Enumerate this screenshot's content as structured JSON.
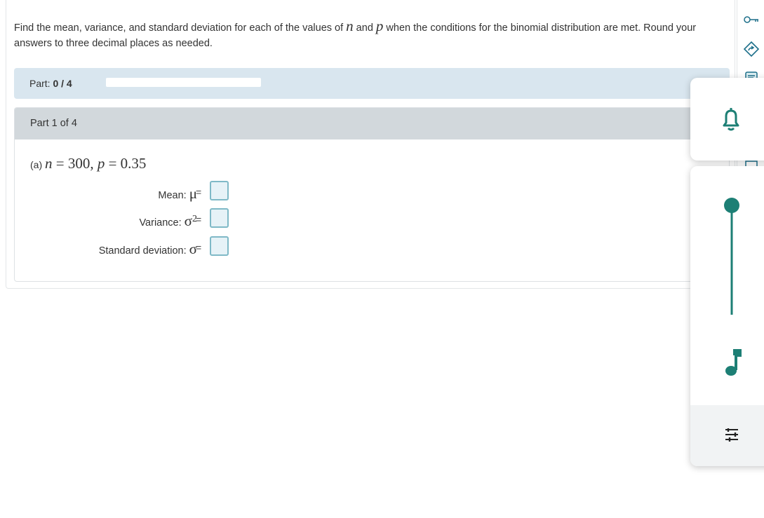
{
  "question": {
    "prompt_before_n": "Find the mean, variance, and standard deviation for each of the values of ",
    "var_n": "n",
    "prompt_and": " and ",
    "var_p": "p",
    "prompt_after_p": " when the conditions for the binomial distribution are met. Round your answers to three decimal places as needed."
  },
  "progress": {
    "label_prefix": "Part: ",
    "label_value": "0 / 4",
    "fraction": 0
  },
  "part": {
    "header": "Part 1 of 4",
    "subq_label": "(a) ",
    "n_var": "n",
    "n_eq": " = 300, ",
    "p_var": "p",
    "p_eq": " = 0.35",
    "rows": [
      {
        "label": "Mean: ",
        "symbol": "μ",
        "sup": "",
        "eq": "="
      },
      {
        "label": "Variance: ",
        "symbol": "σ",
        "sup": "2",
        "eq": "="
      },
      {
        "label": "Standard deviation: ",
        "symbol": "σ",
        "sup": "",
        "eq": "="
      }
    ]
  },
  "toolbar": {
    "icons": [
      "key-icon",
      "tag-arrow-icon",
      "notes-icon",
      "calculator-icon"
    ]
  },
  "float_panel": {
    "icons": [
      "bell-icon",
      "slider-icon",
      "music-note-icon",
      "settings-tune-icon"
    ],
    "slider_level": 1.0,
    "accent": "#1d7f75"
  }
}
